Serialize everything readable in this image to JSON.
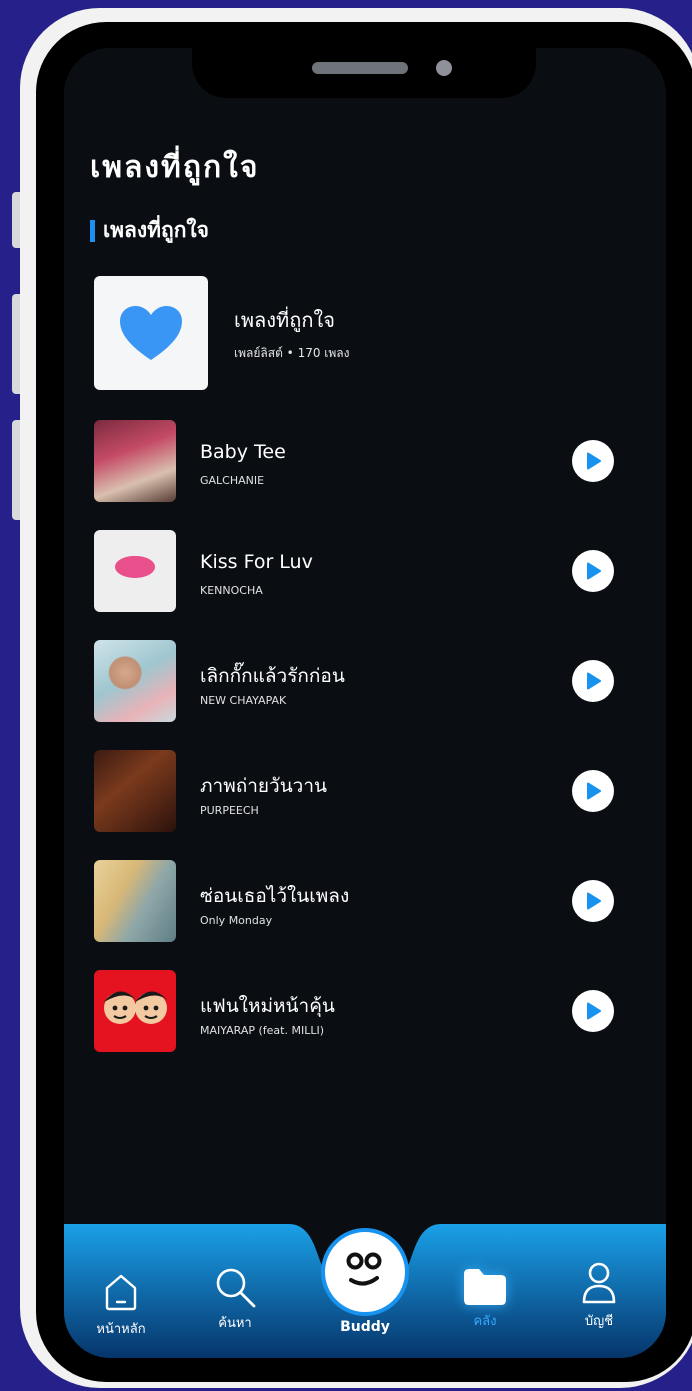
{
  "header": {
    "title": "เพลงที่ถูกใจ"
  },
  "section": {
    "title": "เพลงที่ถูกใจ"
  },
  "playlist": {
    "name": "เพลงที่ถูกใจ",
    "meta": "เพลย์ลิสต์ • 170 เพลง",
    "icon": "heart-icon"
  },
  "songs": [
    {
      "title": "Baby Tee",
      "artist": "GALCHANIE"
    },
    {
      "title": "Kiss For Luv",
      "artist": "KENNOCHA"
    },
    {
      "title": "เลิกกั๊กแล้วรักก่อน",
      "artist": "NEW CHAYAPAK"
    },
    {
      "title": "ภาพถ่ายวันวาน",
      "artist": "PURPEECH"
    },
    {
      "title": "ซ่อนเธอไว้ในเพลง",
      "artist": "Only Monday"
    },
    {
      "title": "แฟนใหม่หน้าคุ้น",
      "artist": "MAIYARAP (feat. MILLI)"
    }
  ],
  "nav": {
    "home": "หน้าหลัก",
    "search": "ค้นหา",
    "buddy": "Buddy",
    "library": "คลัง",
    "account": "บัญชี"
  },
  "colors": {
    "background": "#26218a",
    "accent": "#1793ef",
    "active_tab": "#36a9ff",
    "heart": "#3a96f5"
  }
}
